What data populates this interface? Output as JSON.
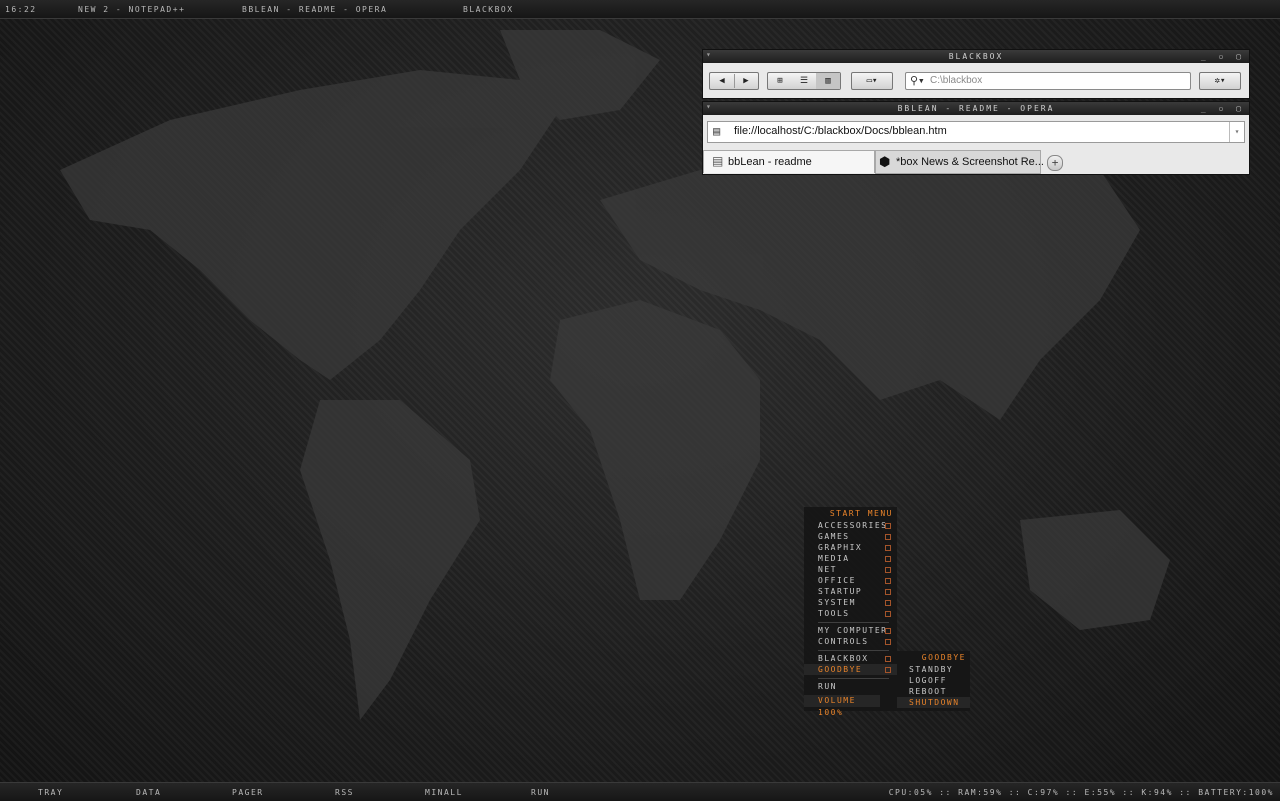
{
  "topbar": {
    "clock": "16:22",
    "tasks": [
      "NEW 2 - NOTEPAD++",
      "BBLEAN - README - OPERA",
      "BLACKBOX"
    ]
  },
  "bottombar": {
    "items": [
      "TRAY",
      "DATA",
      "PAGER",
      "RSS",
      "MINALL",
      "RUN"
    ],
    "sysinfo": "CPU:05% :: RAM:59% :: C:97% :: E:55% :: K:94% :: BATTERY:100%"
  },
  "explorer": {
    "title": "BLACKBOX",
    "search_placeholder": "C:\\blackbox",
    "icons": [
      "back-icon",
      "forward-icon",
      "thumbnails-view-icon",
      "list-view-icon",
      "columns-view-icon",
      "view-menu-icon",
      "settings-icon"
    ]
  },
  "opera": {
    "title": "BBLEAN - README - OPERA",
    "url": "file://localhost/C:/blackbox/Docs/bblean.htm",
    "tabs": [
      "bbLean - readme",
      "*box News & Screenshot Re..."
    ]
  },
  "start_menu": {
    "title": "START MENU",
    "items": [
      "ACCESSORIES",
      "GAMES",
      "GRAPHIX",
      "MEDIA",
      "NET",
      "OFFICE",
      "STARTUP",
      "SYSTEM",
      "TOOLS"
    ],
    "items2": [
      "MY COMPUTER",
      "CONTROLS"
    ],
    "items3": [
      "BLACKBOX",
      "GOODBYE"
    ],
    "run": "RUN",
    "volume": "VOLUME 100%"
  },
  "goodbye_menu": {
    "title": "GOODBYE",
    "items": [
      "STANDBY",
      "LOGOFF",
      "REBOOT",
      "SHUTDOWN"
    ]
  },
  "colors": {
    "accent": "#e8832a",
    "bar": "#1e1e1e",
    "desktop": "#1b1b1b"
  }
}
